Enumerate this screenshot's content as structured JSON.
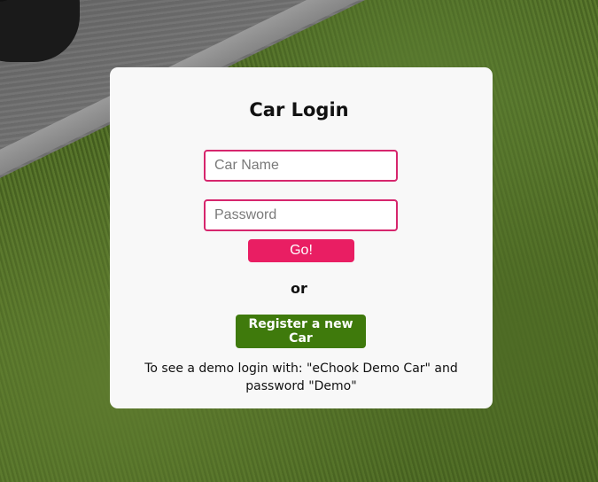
{
  "login": {
    "title": "Car Login",
    "car_name_placeholder": "Car Name",
    "password_placeholder": "Password",
    "go_label": "Go!",
    "or_label": "or",
    "register_label": "Register a new Car",
    "demo_note": "To see a demo login with: \"eChook Demo Car\" and password \"Demo\""
  },
  "colors": {
    "input_border": "#d6266d",
    "go_button": "#e91e63",
    "register_button": "#3f7a0c",
    "card_background": "#f8f8f8"
  }
}
